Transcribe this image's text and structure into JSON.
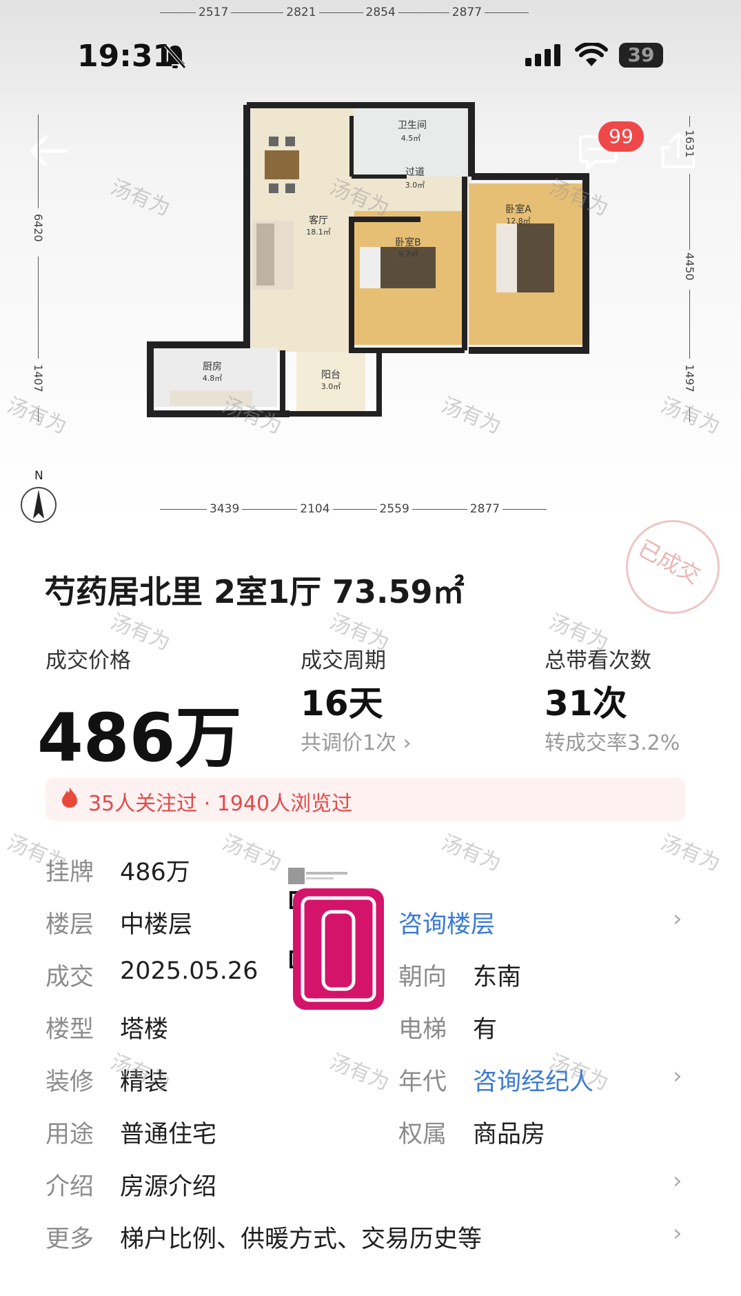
{
  "status_bar": {
    "time": "19:31",
    "battery": "39"
  },
  "nav": {
    "badge_count": "99"
  },
  "floorplan": {
    "top_dims": [
      "2517",
      "2821",
      "2854",
      "2877"
    ],
    "bottom_dims": [
      "3439",
      "2104",
      "2559",
      "2877"
    ],
    "left_dims": [
      "6420",
      "1407"
    ],
    "right_dims": [
      "1631",
      "4450",
      "1497"
    ],
    "compass": "N",
    "rooms": [
      {
        "name": "卫生间",
        "area": "4.5㎡"
      },
      {
        "name": "过道",
        "area": "3.0㎡"
      },
      {
        "name": "客厅",
        "area": "18.1㎡"
      },
      {
        "name": "卧室A",
        "area": "12.8㎡"
      },
      {
        "name": "卧室B",
        "area": "9.7㎡"
      },
      {
        "name": "厨房",
        "area": "4.8㎡"
      },
      {
        "name": "阳台",
        "area": "3.0㎡"
      }
    ]
  },
  "watermark": "汤有为",
  "stamp": "已成交",
  "listing": {
    "title": "芍药居北里 2室1厅 73.59㎡",
    "price_label": "成交价格",
    "price": "486万",
    "cycle_label": "成交周期",
    "cycle_value": "16天",
    "cycle_sub": "共调价1次 ›",
    "views_label": "总带看次数",
    "views_value": "31次",
    "views_sub": "转成交率3.2%",
    "attention": "35人关注过 · 1940人浏览过"
  },
  "details": {
    "listed_label": "挂牌",
    "listed_value": "486万",
    "floor_label": "楼层",
    "floor_value": "中楼层",
    "floor_link": "咨询楼层",
    "deal_label": "成交",
    "deal_value": "2025.05.26",
    "orient_label": "朝向",
    "orient_value": "东南",
    "type_label": "楼型",
    "type_value": "塔楼",
    "elevator_label": "电梯",
    "elevator_value": "有",
    "deco_label": "装修",
    "deco_value": "精装",
    "year_label": "年代",
    "year_link": "咨询经纪人",
    "use_label": "用途",
    "use_value": "普通住宅",
    "owner_label": "权属",
    "owner_value": "商品房",
    "intro_label": "介绍",
    "intro_value": "房源介绍",
    "more_label": "更多",
    "more_value": "梯户比例、供暖方式、交易历史等"
  },
  "colors": {
    "accent_blue": "#3a7ad6",
    "alert_red": "#e14b4b",
    "badge_red": "#f04848",
    "qr_pink": "#d4146a"
  }
}
